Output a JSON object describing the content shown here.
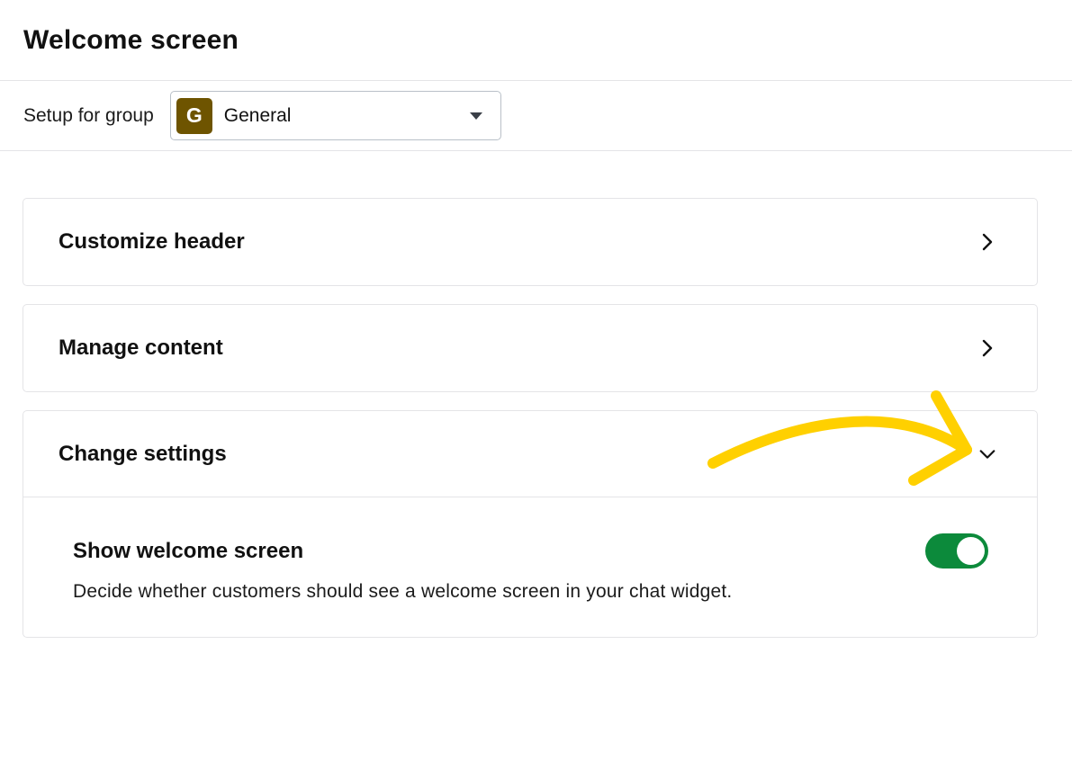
{
  "page": {
    "title": "Welcome screen"
  },
  "group_selector": {
    "label": "Setup for group",
    "avatar_letter": "G",
    "avatar_color": "#6e5400",
    "selected": "General"
  },
  "sections": [
    {
      "title": "Customize header",
      "state": "collapsed",
      "icon": "chevron-right-icon"
    },
    {
      "title": "Manage content",
      "state": "collapsed",
      "icon": "chevron-right-icon"
    },
    {
      "title": "Change settings",
      "state": "expanded",
      "icon": "chevron-down-icon"
    }
  ],
  "settings": {
    "show_welcome": {
      "title": "Show welcome screen",
      "description": "Decide whether customers should see a welcome screen in your chat widget.",
      "enabled": true,
      "toggle_color": "#0c8a3b"
    }
  },
  "annotation": {
    "color": "#ffd000",
    "icon": "arrow-annotation"
  }
}
